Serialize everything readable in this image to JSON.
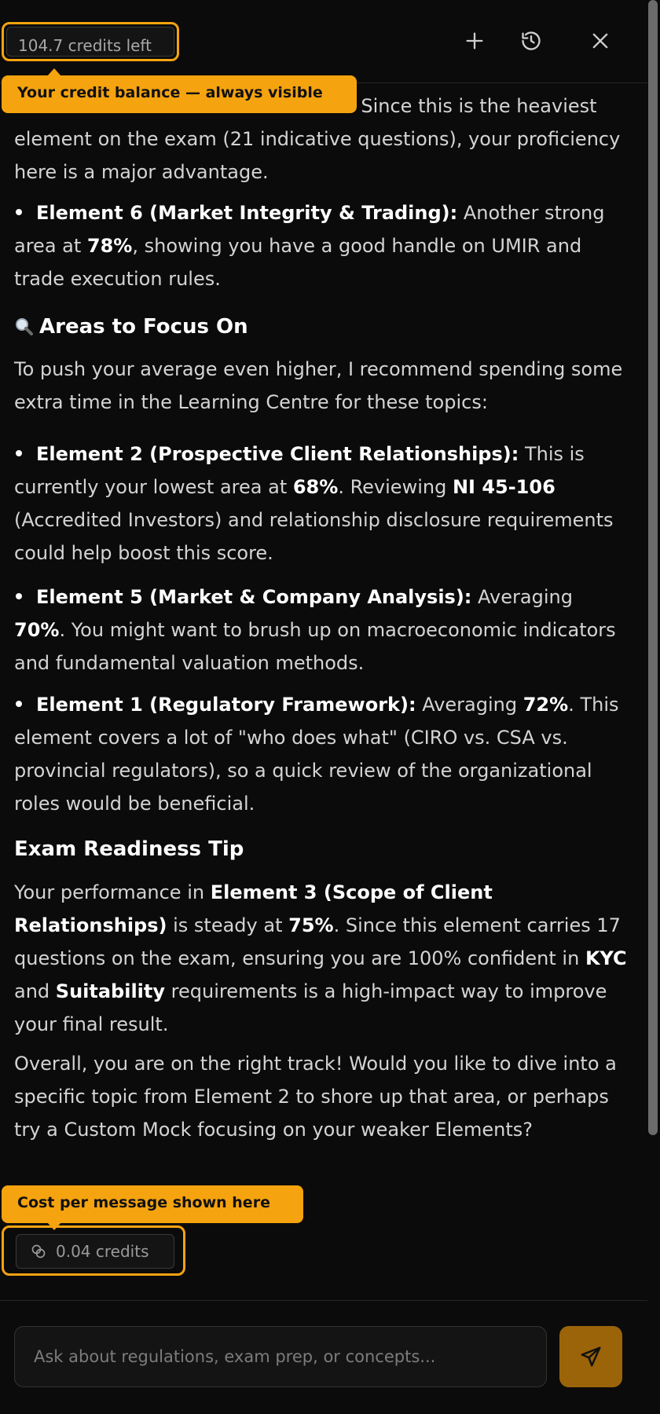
{
  "header": {
    "credits_left": "104.7 credits left",
    "icons": [
      "plus-icon",
      "history-icon",
      "close-icon"
    ]
  },
  "tooltips": {
    "balance": "Your credit balance — always visible",
    "cost": "Cost per message shown here"
  },
  "message": {
    "intro_tail": "re. Since this is the heaviest element on the exam (21 indicative questions), your proficiency here is a major advantage.",
    "strengths": [
      {
        "title": "Element 6 (Market Integrity & Trading):",
        "text_a": " Another strong area at ",
        "pct": "78%",
        "text_b": ", showing you have a good handle on UMIR and trade execution rules."
      }
    ],
    "focus_heading": "Areas to Focus On",
    "focus_intro": "To push your average even higher, I recommend spending some extra time in the Learning Centre for these topics:",
    "focus_items": [
      {
        "title": "Element 2 (Prospective Client Relationships):",
        "text_a": " This is currently your lowest area at ",
        "pct": "68%",
        "text_b": ". Reviewing ",
        "ref": "NI 45-106",
        "text_c": " (Accredited Investors) and relationship disclosure requirements could help boost this score."
      },
      {
        "title": "Element 5 (Market & Company Analysis):",
        "text_a": " Averaging ",
        "pct": "70%",
        "text_b": ". You might want to brush up on macroeconomic indicators and fundamental valuation methods."
      },
      {
        "title": "Element 1 (Regulatory Framework):",
        "text_a": " Averaging ",
        "pct": "72%",
        "text_b": ". This element covers a lot of \"who does what\" (CIRO vs. CSA vs. provincial regulators), so a quick review of the organizational roles would be beneficial."
      }
    ],
    "tip_heading": "Exam Readiness Tip",
    "tip": {
      "text_a": "Your performance in ",
      "element": "Element 3 (Scope of Client Relationships)",
      "text_b": " is steady at ",
      "pct": "75%",
      "text_c": ". Since this element carries 17 questions on the exam, ensuring you are 100% confident in ",
      "kyc": "KYC",
      "text_d": " and ",
      "suitability": "Suitability",
      "text_e": " requirements is a high-impact way to improve your final result."
    },
    "closing": "Overall, you are on the right track! Would you like to dive into a specific topic from Element 2 to shore up that area, or perhaps try a Custom Mock focusing on your weaker Elements?",
    "cost": "0.04 credits"
  },
  "composer": {
    "placeholder": "Ask about regulations, exam prep, or concepts..."
  },
  "colors": {
    "accent": "#f5a30f",
    "send_button": "#9b6409",
    "background": "#0b0b0b"
  }
}
